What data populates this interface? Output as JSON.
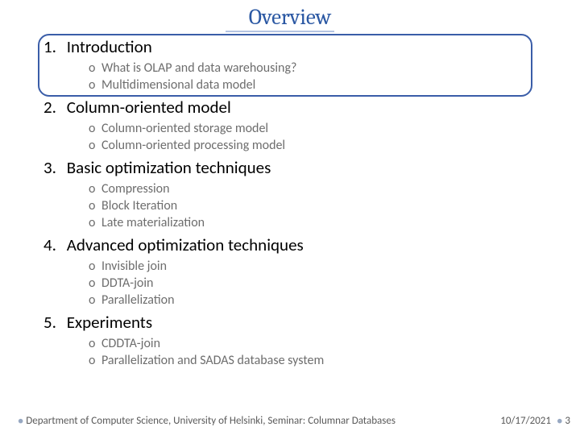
{
  "title": "Overview",
  "sections": [
    {
      "num": "1.",
      "label": "Introduction",
      "subs": [
        "What is OLAP and data warehousing?",
        "Multidimensional data model"
      ]
    },
    {
      "num": "2.",
      "label": "Column-oriented model",
      "subs": [
        "Column-oriented storage model",
        "Column-oriented processing model"
      ]
    },
    {
      "num": "3.",
      "label": "Basic optimization techniques",
      "subs": [
        "Compression",
        "Block Iteration",
        "Late materialization"
      ]
    },
    {
      "num": "4.",
      "label": "Advanced optimization techniques",
      "subs": [
        "Invisible join",
        "DDTA-join",
        "Parallelization"
      ]
    },
    {
      "num": "5.",
      "label": "Experiments",
      "subs": [
        "CDDTA-join",
        "Parallelization and SADAS database system"
      ]
    }
  ],
  "footer": {
    "org": "Department of Computer Science, University of Helsinki, Seminar: Columnar Databases",
    "date": "10/17/2021",
    "page": "3"
  }
}
